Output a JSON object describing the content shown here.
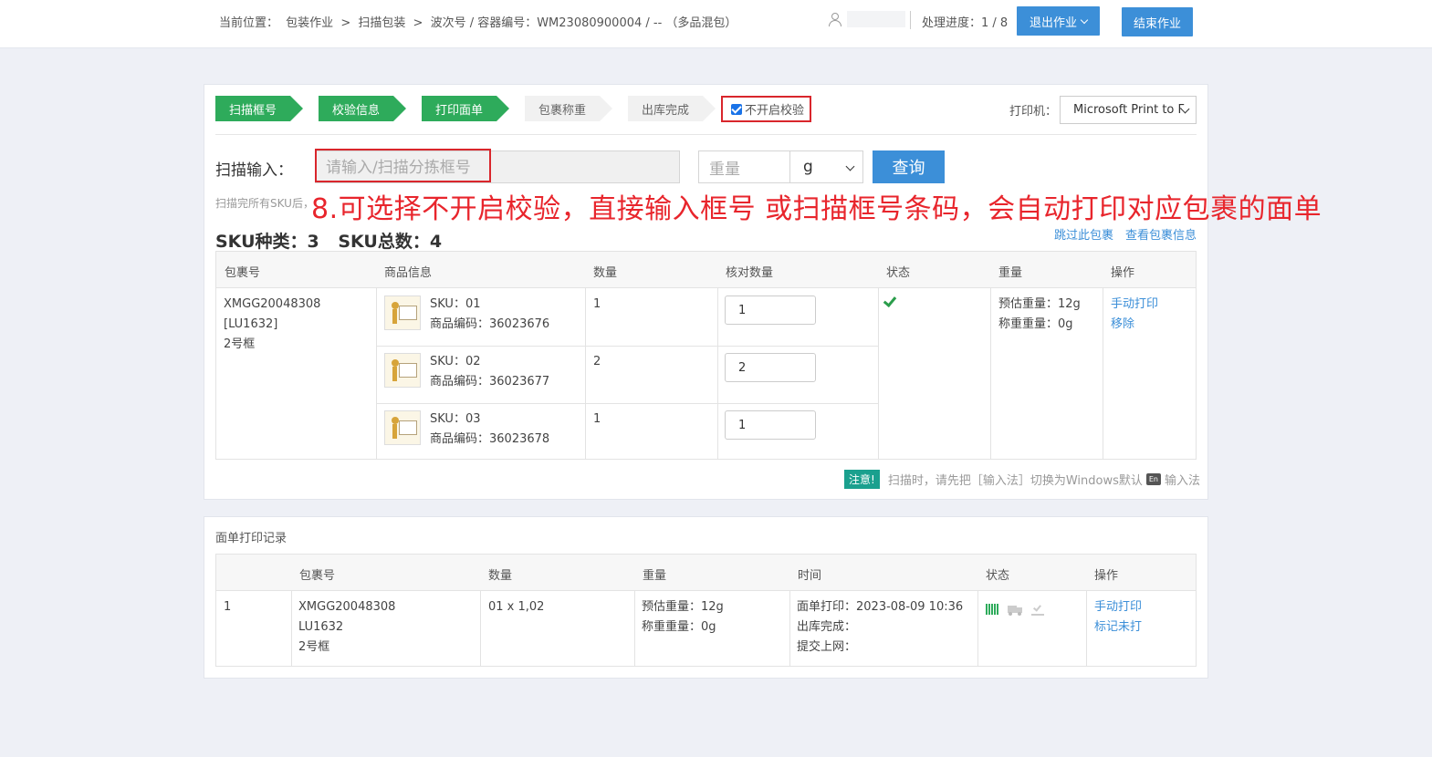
{
  "header": {
    "breadcrumb": [
      "当前位置：",
      "包装作业",
      ">",
      "扫描包装",
      ">",
      "波次号 / 容器编号：WM23080900004 / -- （多品混包）"
    ],
    "progress": "处理进度：1 / 8",
    "exit_label": "退出作业",
    "end_label": "结束作业"
  },
  "steps": [
    {
      "label": "扫描框号",
      "state": "done"
    },
    {
      "label": "校验信息",
      "state": "done"
    },
    {
      "label": "打印面单",
      "state": "done"
    },
    {
      "label": "包裹称重",
      "state": "todo"
    },
    {
      "label": "出库完成",
      "state": "todo"
    }
  ],
  "no_verify": {
    "label": "不开启校验",
    "checked": true
  },
  "printer": {
    "label": "打印机：",
    "value": "Microsoft Print to F"
  },
  "scan": {
    "label": "扫描输入：",
    "placeholder": "请输入/扫描分拣框号",
    "weight_placeholder": "重量",
    "unit": "g",
    "query_label": "查询",
    "hint": "扫描完所有SKU后，"
  },
  "overlay_note": "8.可选择不开启校验，直接输入框号 或扫描框号条码，会自动打印对应包裹的面单",
  "summary": {
    "sku_types": "SKU种类：3",
    "sku_total": "SKU总数：4"
  },
  "links": {
    "skip": "跳过此包裹",
    "view": "查看包裹信息"
  },
  "main_table": {
    "headers": [
      "包裹号",
      "商品信息",
      "数量",
      "核对数量",
      "状态",
      "重量",
      "操作"
    ],
    "package": [
      "XMGG20048308",
      "[LU1632]",
      "2号框"
    ],
    "items": [
      {
        "sku": "SKU：01",
        "code": "商品编码：36023676",
        "qty": "1",
        "check_qty": "1"
      },
      {
        "sku": "SKU：02",
        "code": "商品编码：36023677",
        "qty": "2",
        "check_qty": "2"
      },
      {
        "sku": "SKU：03",
        "code": "商品编码：36023678",
        "qty": "1",
        "check_qty": "1"
      }
    ],
    "status_icon": "check-icon",
    "weight": [
      "预估重量：12g",
      "称重重量：0g"
    ],
    "actions": [
      "手动打印",
      "移除"
    ]
  },
  "notice": {
    "badge": "注意!",
    "text": "扫描时，请先把［输入法］切换为Windows默认",
    "en": "En",
    "tail": "输入法"
  },
  "log": {
    "title": "面单打印记录",
    "headers": [
      "包裹号",
      "数量",
      "重量",
      "时间",
      "状态",
      "操作"
    ],
    "row": {
      "index": "1",
      "package": [
        "XMGG20048308",
        "LU1632",
        "2号框"
      ],
      "qty": "01 x 1,02",
      "weight": [
        "预估重量：12g",
        "称重重量：0g"
      ],
      "time": [
        "面单打印：2023-08-09 10:36",
        "出库完成：",
        "提交上网："
      ],
      "status_icons": [
        "barcode-icon",
        "truck-icon",
        "done-icon"
      ],
      "actions": [
        "手动打印",
        "标记未打"
      ]
    }
  },
  "colors": {
    "accent": "#3c8fd8",
    "step_done": "#2eab5b",
    "highlight": "#d9262c",
    "note": "#e8252c"
  }
}
